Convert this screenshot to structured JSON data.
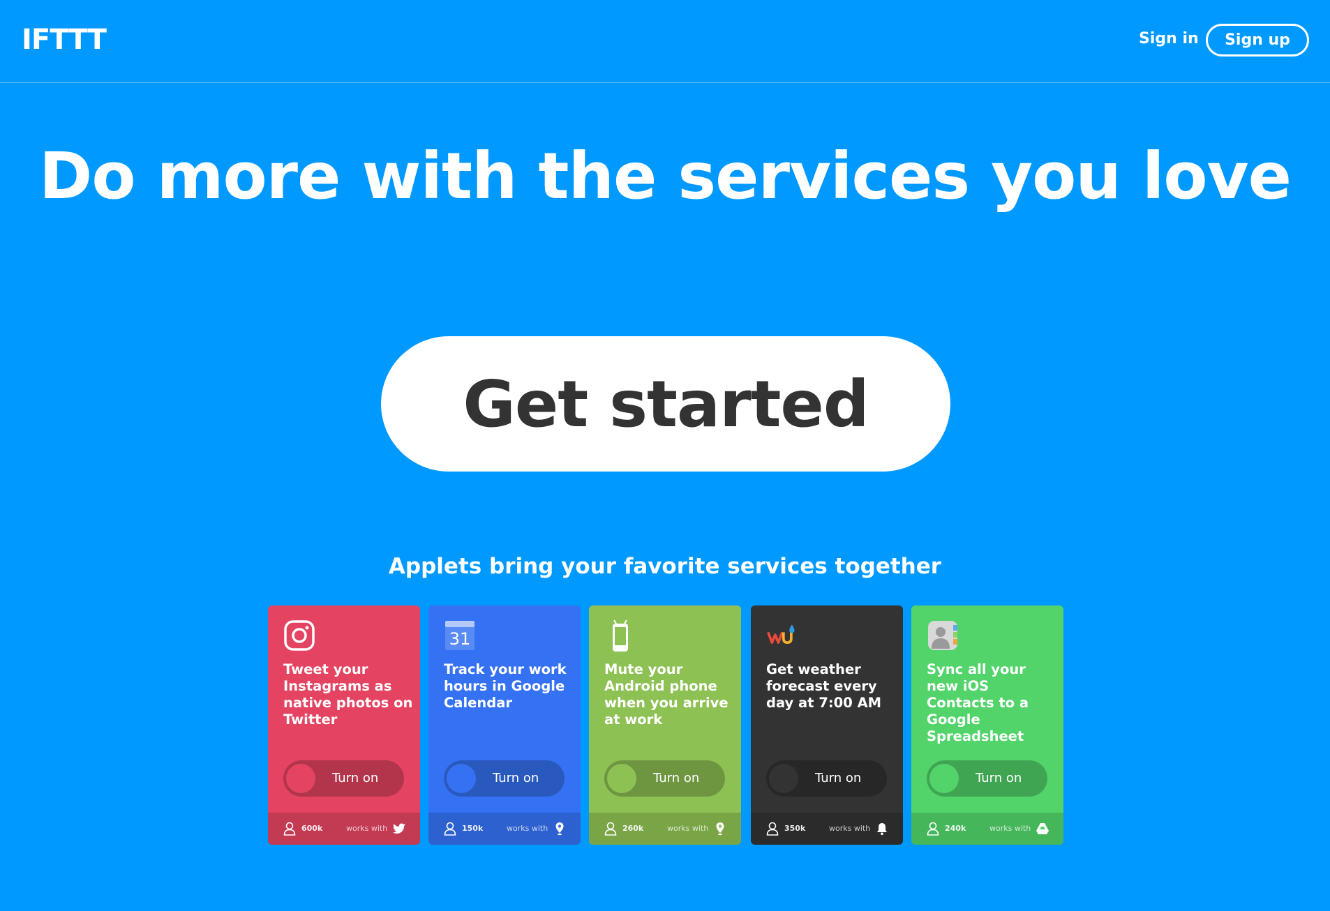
{
  "header": {
    "logo": "IFTTT",
    "sign_in": "Sign in",
    "sign_up": "Sign up"
  },
  "hero": {
    "title": "Do more with the services you love",
    "cta": "Get started",
    "subtitle": "Applets bring your favorite services together"
  },
  "cards": [
    {
      "text": "Tweet your Instagrams as native photos on Twitter",
      "toggle": "Turn on",
      "users": "600k",
      "works_with": "works with",
      "bg": "#e44461",
      "icon": "instagram-icon",
      "service_icon": "twitter-icon"
    },
    {
      "text": "Track your work hours in Google Calendar",
      "toggle": "Turn on",
      "users": "150k",
      "works_with": "works with",
      "bg": "#3572f3",
      "icon": "google-calendar-icon",
      "calendar_day": "31",
      "service_icon": "location-pin-icon"
    },
    {
      "text": "Mute your Android phone when you arrive at work",
      "toggle": "Turn on",
      "users": "260k",
      "works_with": "works with",
      "bg": "#8dc153",
      "icon": "android-phone-icon",
      "service_icon": "location-pin-icon"
    },
    {
      "text": "Get weather forecast every day at 7:00 AM",
      "toggle": "Turn on",
      "users": "350k",
      "works_with": "works with",
      "bg": "#333333",
      "icon": "weather-underground-icon",
      "service_icon": "notification-bell-icon"
    },
    {
      "text": "Sync all your new iOS Contacts to a Google Spreadsheet",
      "toggle": "Turn on",
      "users": "240k",
      "works_with": "works with",
      "bg": "#52d46a",
      "icon": "ios-contacts-icon",
      "service_icon": "google-drive-icon"
    }
  ]
}
